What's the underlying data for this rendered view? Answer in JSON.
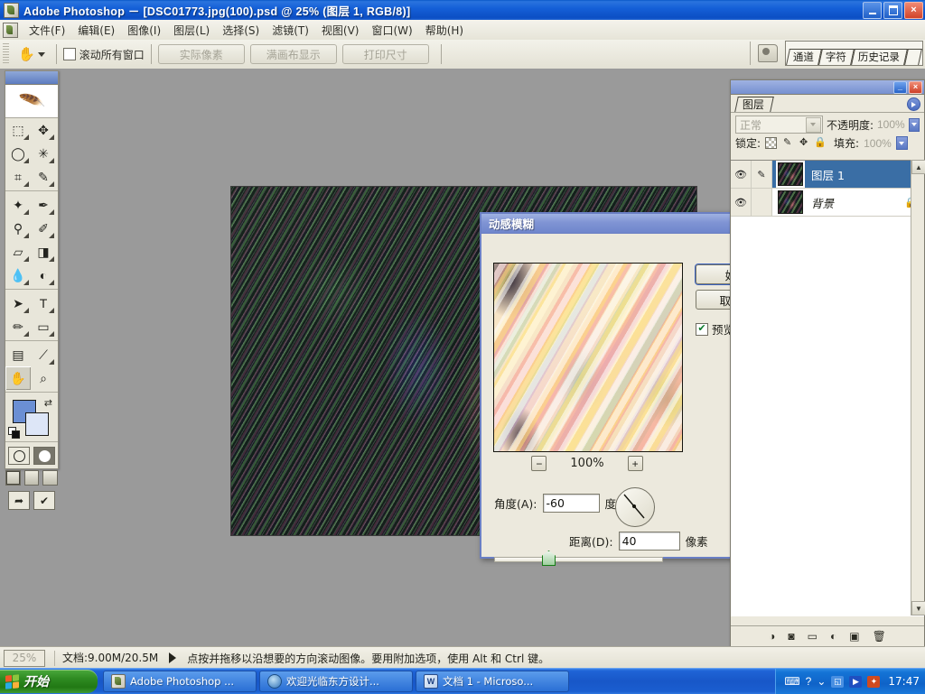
{
  "window": {
    "title": "Adobe Photoshop － [DSC01773.jpg(100).psd @ 25% (图层 1, RGB/8)]",
    "minimize_label": "",
    "maximize_label": "",
    "close_label": "×"
  },
  "menubar": {
    "items": [
      {
        "label": "文件(F)"
      },
      {
        "label": "编辑(E)"
      },
      {
        "label": "图像(I)"
      },
      {
        "label": "图层(L)"
      },
      {
        "label": "选择(S)"
      },
      {
        "label": "滤镜(T)"
      },
      {
        "label": "视图(V)"
      },
      {
        "label": "窗口(W)"
      },
      {
        "label": "帮助(H)"
      }
    ]
  },
  "options_bar": {
    "tool_icon": "hand-tool-icon",
    "scroll_all_windows": "滚动所有窗口",
    "scroll_all_windows_checked": false,
    "buttons": [
      {
        "label": "实际像素"
      },
      {
        "label": "满画布显示"
      },
      {
        "label": "打印尺寸"
      }
    ],
    "palette_well_tabs": [
      {
        "label": "通道"
      },
      {
        "label": "字符"
      },
      {
        "label": "历史记录"
      }
    ]
  },
  "toolbox": {
    "tools": [
      {
        "name": "marquee-tool",
        "glyph": "⬚"
      },
      {
        "name": "move-tool",
        "glyph": "✥"
      },
      {
        "name": "lasso-tool",
        "glyph": "◯"
      },
      {
        "name": "magic-wand-tool",
        "glyph": "✳"
      },
      {
        "name": "crop-tool",
        "glyph": "⌗"
      },
      {
        "name": "slice-tool",
        "glyph": "✎"
      },
      {
        "name": "healing-brush-tool",
        "glyph": "✦"
      },
      {
        "name": "brush-tool",
        "glyph": "✒"
      },
      {
        "name": "clone-stamp-tool",
        "glyph": "⚲"
      },
      {
        "name": "history-brush-tool",
        "glyph": "✐"
      },
      {
        "name": "eraser-tool",
        "glyph": "▱"
      },
      {
        "name": "gradient-tool",
        "glyph": "◨"
      },
      {
        "name": "blur-tool",
        "glyph": "💧"
      },
      {
        "name": "dodge-tool",
        "glyph": "◐"
      },
      {
        "name": "path-selection-tool",
        "glyph": "➤"
      },
      {
        "name": "type-tool",
        "glyph": "T"
      },
      {
        "name": "pen-tool",
        "glyph": "✏"
      },
      {
        "name": "shape-tool",
        "glyph": "▭"
      },
      {
        "name": "notes-tool",
        "glyph": "▤"
      },
      {
        "name": "eyedropper-tool",
        "glyph": "⟋"
      },
      {
        "name": "hand-tool",
        "glyph": "✋"
      },
      {
        "name": "zoom-tool",
        "glyph": "⌕"
      }
    ],
    "foreground_color": "#6b8fd4",
    "background_color": "#dde6f7"
  },
  "document": {
    "zoom": "25%",
    "doc_info": "文档:9.00M/20.5M",
    "status_hint": "点按并拖移以沿想要的方向滚动图像。要用附加选项，使用 Alt 和 Ctrl 键。"
  },
  "dialog": {
    "title": "动感模糊",
    "close_label": "×",
    "preview_zoom": "100%",
    "zoom_out_label": "−",
    "zoom_in_label": "+",
    "ok_label": "好",
    "cancel_label": "取消",
    "preview_checkbox_label": "预览(P)",
    "preview_checked": true,
    "angle_label": "角度(A):",
    "angle_value": "-60",
    "angle_unit": "度",
    "distance_label": "距离(D):",
    "distance_value": "40",
    "distance_unit": "像素"
  },
  "layers_panel": {
    "tab_label": "图层",
    "blend_mode": "正常",
    "opacity_label": "不透明度:",
    "opacity_value": "100%",
    "lock_label": "锁定:",
    "fill_label": "填充:",
    "fill_value": "100%",
    "lock_icons": [
      "transparency-lock-icon",
      "pixels-lock-icon",
      "position-lock-icon",
      "all-lock-icon"
    ],
    "layers": [
      {
        "name": "图层 1",
        "visible": true,
        "selected": true,
        "locked": false,
        "italic": false
      },
      {
        "name": "背景",
        "visible": true,
        "selected": false,
        "locked": true,
        "italic": true
      }
    ],
    "footer_icons": [
      {
        "name": "layer-style-icon",
        "glyph": "◑"
      },
      {
        "name": "layer-mask-icon",
        "glyph": "◙"
      },
      {
        "name": "new-group-icon",
        "glyph": "▭"
      },
      {
        "name": "adjustment-layer-icon",
        "glyph": "◐"
      },
      {
        "name": "new-layer-icon",
        "glyph": "▣"
      },
      {
        "name": "delete-layer-icon",
        "glyph": "🗑"
      }
    ]
  },
  "taskbar": {
    "start_label": "开始",
    "tasks": [
      {
        "label": "Adobe Photoshop ...",
        "icon": "photoshop-icon"
      },
      {
        "label": "欢迎光临东方设计...",
        "icon": "internet-explorer-icon"
      },
      {
        "label": "文档 1 - Microso...",
        "icon": "word-icon"
      }
    ],
    "tray": {
      "time": "17:47",
      "icons": [
        "keyboard-icon",
        "help-icon",
        "show-hidden-icon",
        "network-icon",
        "media-player-icon",
        "antivirus-icon"
      ]
    }
  },
  "colors": {
    "title_blue": "#1560d8",
    "dialog_border": "#6a7fc4",
    "panel_bg": "#ece9dd",
    "selection_blue": "#3a6ea5",
    "desktop_gray": "#9a9a9a"
  }
}
